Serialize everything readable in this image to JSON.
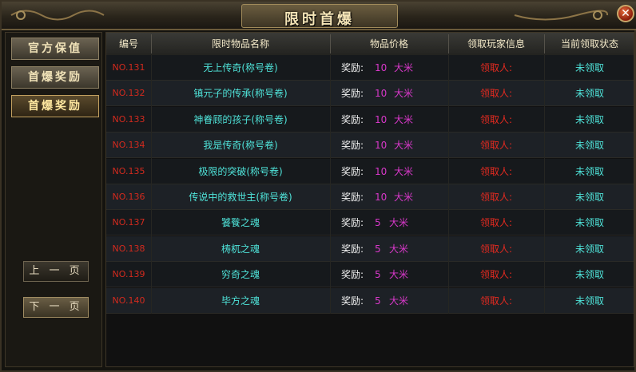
{
  "window": {
    "title": "限时首爆",
    "close_symbol": "✕"
  },
  "sidebar": {
    "items": [
      {
        "label": "官方保值",
        "active": false
      },
      {
        "label": "首爆奖励",
        "active": false
      },
      {
        "label": "首爆奖励",
        "active": true
      }
    ],
    "prev_page": "上 一 页",
    "next_page": "下 一 页"
  },
  "table": {
    "headers": [
      "编号",
      "限时物品名称",
      "物品价格",
      "领取玩家信息",
      "当前领取状态"
    ],
    "rows": [
      {
        "no": "NO.131",
        "name": "无上传奇(称号卷)",
        "reward_label": "奖励:",
        "reward_amount": "10",
        "reward_unit": "大米",
        "player": "领取人:",
        "status": "未领取"
      },
      {
        "no": "NO.132",
        "name": "镇元子的传承(称号卷)",
        "reward_label": "奖励:",
        "reward_amount": "10",
        "reward_unit": "大米",
        "player": "领取人:",
        "status": "未领取"
      },
      {
        "no": "NO.133",
        "name": "神眷顾的孩子(称号卷)",
        "reward_label": "奖励:",
        "reward_amount": "10",
        "reward_unit": "大米",
        "player": "领取人:",
        "status": "未领取"
      },
      {
        "no": "NO.134",
        "name": "我是传奇(称号卷)",
        "reward_label": "奖励:",
        "reward_amount": "10",
        "reward_unit": "大米",
        "player": "领取人:",
        "status": "未领取"
      },
      {
        "no": "NO.135",
        "name": "极限的突破(称号卷)",
        "reward_label": "奖励:",
        "reward_amount": "10",
        "reward_unit": "大米",
        "player": "领取人:",
        "status": "未领取"
      },
      {
        "no": "NO.136",
        "name": "传说中的救世主(称号卷)",
        "reward_label": "奖励:",
        "reward_amount": "10",
        "reward_unit": "大米",
        "player": "领取人:",
        "status": "未领取"
      },
      {
        "no": "NO.137",
        "name": "饕餮之魂",
        "reward_label": "奖励:",
        "reward_amount": "5",
        "reward_unit": "大米",
        "player": "领取人:",
        "status": "未领取"
      },
      {
        "no": "NO.138",
        "name": "梼杌之魂",
        "reward_label": "奖励:",
        "reward_amount": "5",
        "reward_unit": "大米",
        "player": "领取人:",
        "status": "未领取"
      },
      {
        "no": "NO.139",
        "name": "穷奇之魂",
        "reward_label": "奖励:",
        "reward_amount": "5",
        "reward_unit": "大米",
        "player": "领取人:",
        "status": "未领取"
      },
      {
        "no": "NO.140",
        "name": "毕方之魂",
        "reward_label": "奖励:",
        "reward_amount": "5",
        "reward_unit": "大米",
        "player": "领取人:",
        "status": "未领取"
      }
    ]
  },
  "colors": {
    "number": "#d22a1e",
    "item_name": "#4fe3d9",
    "reward_value": "#d838c9",
    "player": "#e52a20",
    "status": "#4fe3d9",
    "title": "#f6e6b8"
  }
}
